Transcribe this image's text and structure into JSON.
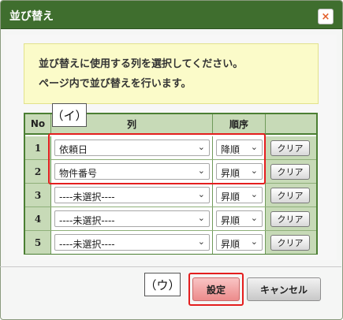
{
  "dialog": {
    "title": "並び替え",
    "close_icon": "×",
    "close_color": "#e35e2a"
  },
  "info": {
    "line1": "並び替えに使用する列を選択してください。",
    "line2": "ページ内で並び替えを行います。"
  },
  "table": {
    "headers": {
      "no": "No",
      "column": "列",
      "order": "順序"
    },
    "rows": [
      {
        "no": "1",
        "column": "依頼日",
        "order": "降順",
        "clear": "クリア"
      },
      {
        "no": "2",
        "column": "物件番号",
        "order": "昇順",
        "clear": "クリア"
      },
      {
        "no": "3",
        "column": "----未選択----",
        "order": "昇順",
        "clear": "クリア"
      },
      {
        "no": "4",
        "column": "----未選択----",
        "order": "昇順",
        "clear": "クリア"
      },
      {
        "no": "5",
        "column": "----未選択----",
        "order": "昇順",
        "clear": "クリア"
      }
    ]
  },
  "annotations": {
    "i_label": "（イ）",
    "u_label": "（ウ）",
    "color": "#e41e1e"
  },
  "footer": {
    "confirm_label": "設定",
    "cancel_label": "キャンセル"
  }
}
